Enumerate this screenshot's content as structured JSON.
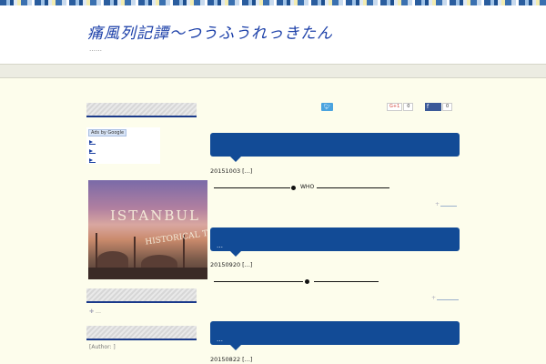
{
  "header": {
    "site_title": "痛風列記譚～つうふうれっきたん",
    "site_description": "……"
  },
  "sidebar": {
    "ads_label": "Ads by Google",
    "ad_image": {
      "title": "ISTANBUL",
      "subtitle": "HISTORICAL TOURISM"
    },
    "recent_link": "…",
    "author": "[Author: ]"
  },
  "share": {
    "twitter_icon": "twitter-bird-icon",
    "gplus_label": "G+1",
    "gplus_count": "0",
    "facebook_count": "0"
  },
  "posts": [
    {
      "title": "",
      "date": "20151003 [...]",
      "divider_text": "WHO",
      "read_more_glyph": "+"
    },
    {
      "title": "…",
      "date": "20150920 [...]",
      "divider_text": "",
      "read_more_glyph": "+"
    },
    {
      "title": "…",
      "date": "20150822 [...]",
      "divider_text": "",
      "read_more_glyph": ""
    }
  ],
  "colors": {
    "accent": "#124b96",
    "title": "#1b3fa8",
    "background": "#fdfdec"
  }
}
